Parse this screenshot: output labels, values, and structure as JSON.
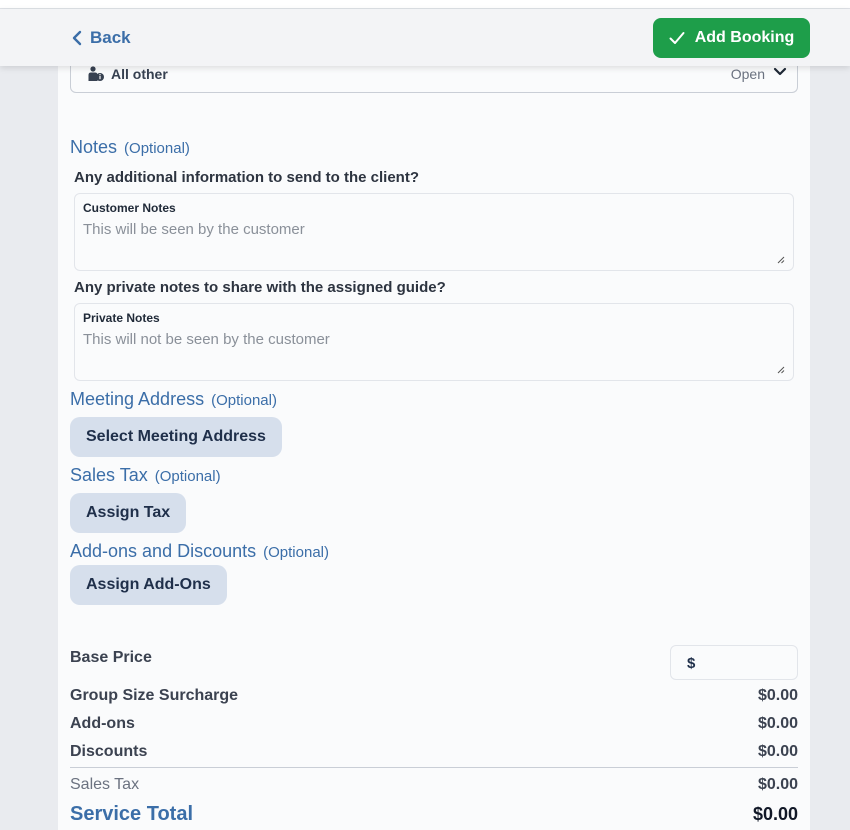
{
  "header": {
    "back_label": "Back",
    "add_booking_label": "Add Booking"
  },
  "category_select": {
    "label": "All other",
    "status": "Open"
  },
  "notes": {
    "title": "Notes",
    "optional": "(Optional)",
    "customer_question": "Any additional information to send to the client?",
    "customer_label": "Customer Notes",
    "customer_placeholder": "This will be seen by the customer",
    "private_question": "Any private notes to share with the assigned guide?",
    "private_label": "Private Notes",
    "private_placeholder": "This will not be seen by the customer"
  },
  "meeting_address": {
    "title": "Meeting Address",
    "optional": "(Optional)",
    "button_label": "Select Meeting Address"
  },
  "sales_tax": {
    "title": "Sales Tax",
    "optional": "(Optional)",
    "button_label": "Assign Tax"
  },
  "addons": {
    "title": "Add-ons and Discounts",
    "optional": "(Optional)",
    "button_label": "Assign Add-Ons"
  },
  "pricing": {
    "base_price_label": "Base Price",
    "currency_symbol": "$",
    "base_price_value": "",
    "group_surcharge_label": "Group Size Surcharge",
    "group_surcharge_value": "$0.00",
    "addons_label": "Add-ons",
    "addons_value": "$0.00",
    "discounts_label": "Discounts",
    "discounts_value": "$0.00",
    "sales_tax_label": "Sales Tax",
    "sales_tax_value": "$0.00",
    "service_total_label": "Service Total",
    "service_total_value": "$0.00"
  },
  "colors": {
    "accent_blue": "#3b6ea8",
    "add_button_green": "#1e9e4a",
    "pill_bg": "#d6dfec"
  }
}
